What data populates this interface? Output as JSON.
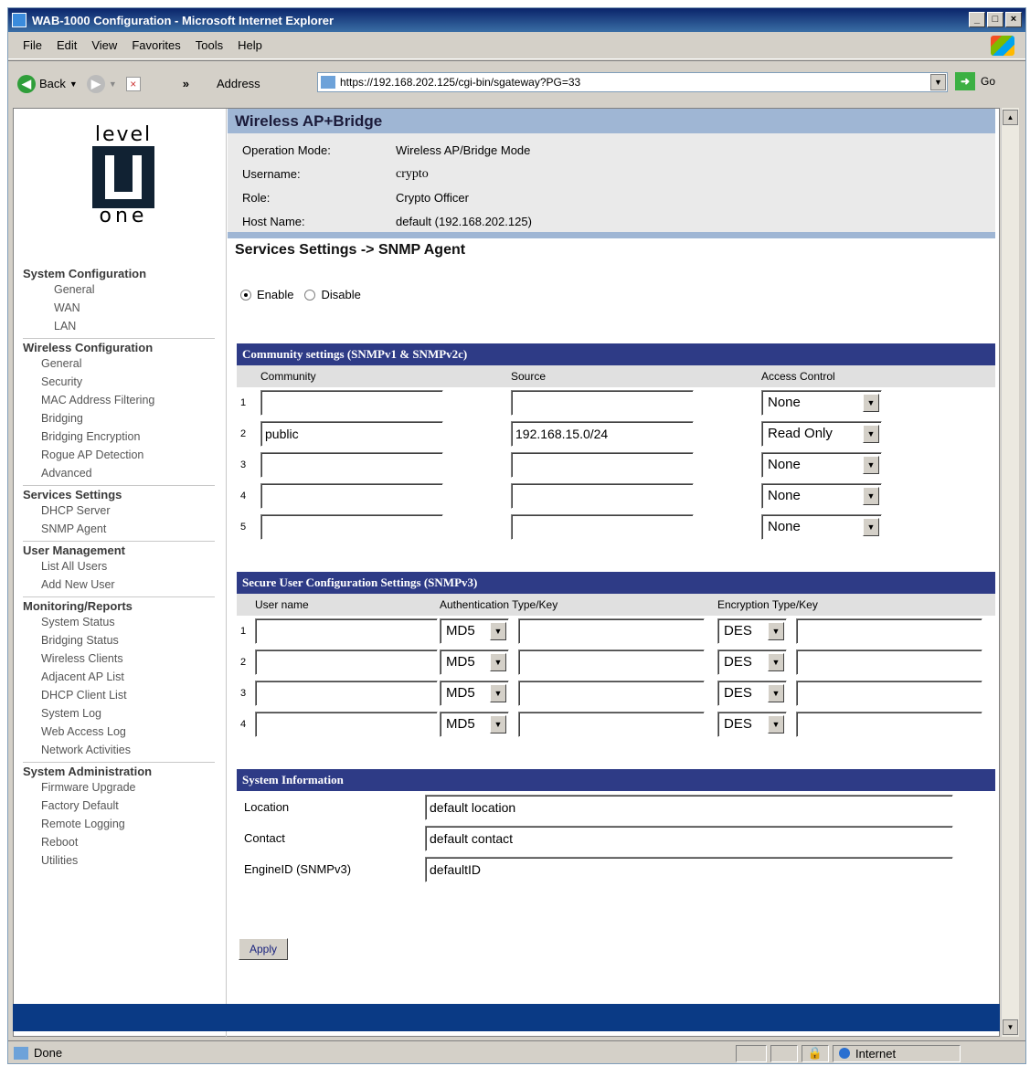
{
  "window": {
    "title": "WAB-1000 Configuration - Microsoft Internet Explorer"
  },
  "menu": [
    "File",
    "Edit",
    "View",
    "Favorites",
    "Tools",
    "Help"
  ],
  "toolbar": {
    "back": "Back",
    "address_label": "Address",
    "url": "https://192.168.202.125/cgi-bin/sgateway?PG=33",
    "go": "Go",
    "chevrons": "»"
  },
  "logo": {
    "top": "level",
    "bottom": "one"
  },
  "sidebar": {
    "sections": [
      {
        "title": "System Configuration",
        "items": [
          "General",
          "WAN",
          "LAN"
        ]
      },
      {
        "title": "Wireless Configuration",
        "items": [
          "General",
          "Security",
          "MAC Address Filtering",
          "Bridging",
          "Bridging Encryption",
          "Rogue AP Detection",
          "Advanced"
        ]
      },
      {
        "title": "Services Settings",
        "items": [
          "DHCP Server",
          "SNMP Agent"
        ]
      },
      {
        "title": "User Management",
        "items": [
          "List All Users",
          "Add New User"
        ]
      },
      {
        "title": "Monitoring/Reports",
        "items": [
          "System Status",
          "Bridging Status",
          "Wireless Clients",
          "Adjacent AP List",
          "DHCP Client List",
          "System Log",
          "Web Access Log",
          "Network Activities"
        ]
      },
      {
        "title": "System Administration",
        "items": [
          "Firmware Upgrade",
          "Factory Default",
          "Remote Logging",
          "Reboot",
          "Utilities"
        ]
      }
    ]
  },
  "banner": "Wireless AP+Bridge",
  "info": {
    "mode_label": "Operation Mode:",
    "mode": "Wireless AP/Bridge Mode",
    "user_label": "Username:",
    "user": "crypto",
    "role_label": "Role:",
    "role": "Crypto Officer",
    "host_label": "Host Name:",
    "host": "default (192.168.202.125)"
  },
  "page_title": "Services Settings -> SNMP Agent",
  "radio": {
    "enable": "Enable",
    "disable": "Disable",
    "selected": "Enable"
  },
  "community": {
    "title": "Community settings (SNMPv1 & SNMPv2c)",
    "headers": [
      "Community",
      "Source",
      "Access Control"
    ],
    "rows": [
      {
        "n": "1",
        "community": "",
        "source": "",
        "access": "None"
      },
      {
        "n": "2",
        "community": "public",
        "source": "192.168.15.0/24",
        "access": "Read Only"
      },
      {
        "n": "3",
        "community": "",
        "source": "",
        "access": "None"
      },
      {
        "n": "4",
        "community": "",
        "source": "",
        "access": "None"
      },
      {
        "n": "5",
        "community": "",
        "source": "",
        "access": "None"
      }
    ]
  },
  "secure": {
    "title": "Secure User Configuration Settings (SNMPv3)",
    "headers": [
      "User name",
      "Authentication Type/Key",
      "Encryption Type/Key"
    ],
    "rows": [
      {
        "n": "1",
        "user": "",
        "auth": "MD5",
        "auth_key": "",
        "enc": "DES",
        "enc_key": ""
      },
      {
        "n": "2",
        "user": "",
        "auth": "MD5",
        "auth_key": "",
        "enc": "DES",
        "enc_key": ""
      },
      {
        "n": "3",
        "user": "",
        "auth": "MD5",
        "auth_key": "",
        "enc": "DES",
        "enc_key": ""
      },
      {
        "n": "4",
        "user": "",
        "auth": "MD5",
        "auth_key": "",
        "enc": "DES",
        "enc_key": ""
      }
    ]
  },
  "sysinfo": {
    "title": "System Information",
    "location_label": "Location",
    "location": "default location",
    "contact_label": "Contact",
    "contact": "default contact",
    "engine_label": "EngineID (SNMPv3)",
    "engine": "defaultID"
  },
  "apply": "Apply",
  "status": {
    "text": "Done",
    "zone": "Internet"
  }
}
